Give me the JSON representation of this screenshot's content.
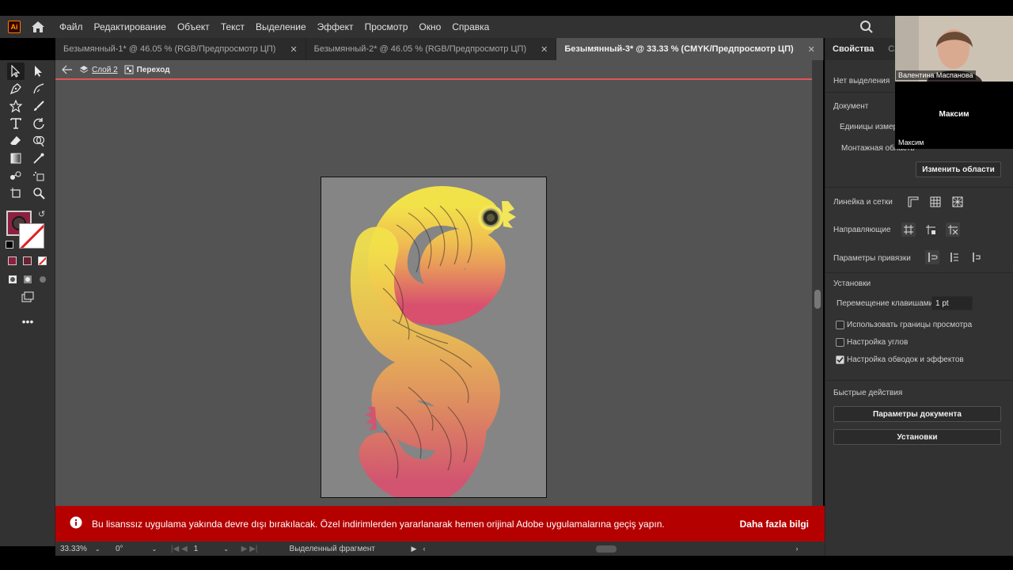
{
  "menubar": {
    "logo": "Ai",
    "items": [
      "Файл",
      "Редактирование",
      "Объект",
      "Текст",
      "Выделение",
      "Эффект",
      "Просмотр",
      "Окно",
      "Справка"
    ]
  },
  "tabs": [
    {
      "label": "Безымянный-1* @ 46.05 % (RGB/Предпросмотр ЦП)",
      "close": "✕"
    },
    {
      "label": "Безымянный-2* @ 46.05 % (RGB/Предпросмотр ЦП)",
      "close": "✕"
    },
    {
      "label": "Безымянный-3* @ 33.33 % (CMYK/Предпросмотр ЦП)",
      "close": "✕"
    }
  ],
  "breadcrumb": {
    "layer": "Слой 2",
    "group": "Переход"
  },
  "banner": {
    "message": "Bu lisanssız uygulama yakında devre dışı bırakılacak. Özel indirimlerden yararlanarak hemen orijinal Adobe uygulamalarına geçiş yapın.",
    "more": "Daha fazla bilgi"
  },
  "statusbar": {
    "zoom": "33.33%",
    "rotation": "0°",
    "artboard": "1",
    "tool": "Выделенный фрагмент"
  },
  "panel": {
    "tab_properties": "Свойства",
    "tab_layers": "Слои",
    "no_selection": "Нет выделения",
    "document": "Документ",
    "units": "Единицы измерения",
    "artboard": "Монтажная область",
    "edit_artboards": "Изменить области",
    "rulers_grids": "Линейка и сетки",
    "guides": "Направляющие",
    "snap_options": "Параметры привязки",
    "preferences": "Установки",
    "keyboard_increment": "Перемещение клавишами:",
    "keyboard_increment_value": "1 pt",
    "use_preview_bounds": "Использовать границы просмотра",
    "scale_corners": "Настройка углов",
    "scale_strokes": "Настройка обводок и эффектов",
    "quick_actions": "Быстрые действия",
    "doc_setup": "Параметры документа",
    "prefs_button": "Установки"
  },
  "video": {
    "person1": "Валентина Маспанова",
    "person2": "Максим",
    "person2_label": "Максим"
  }
}
